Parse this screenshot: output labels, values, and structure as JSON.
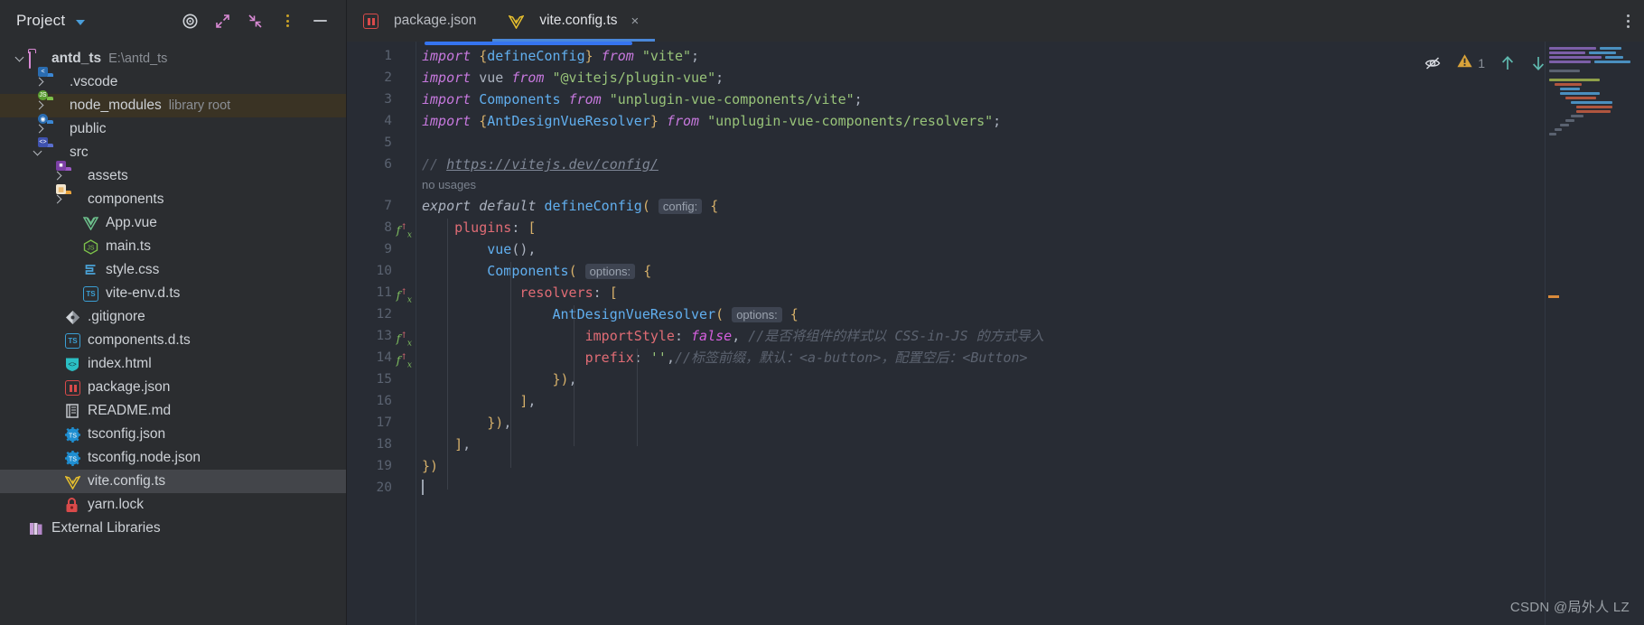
{
  "sidebar": {
    "title": "Project",
    "title_chevron": "chevron-down-icon",
    "actions": [
      {
        "name": "select-opened-file-icon",
        "label": "Select Opened File"
      },
      {
        "name": "expand-all-icon",
        "label": "Expand All"
      },
      {
        "name": "collapse-all-icon",
        "label": "Collapse All"
      },
      {
        "name": "options-menu-icon",
        "label": "Options"
      },
      {
        "name": "hide-icon",
        "label": "Hide"
      }
    ],
    "tree": [
      {
        "label": "antd_ts",
        "secondary": "E:\\antd_ts",
        "arrow": "down",
        "icon": "folder-root-icon",
        "depth": 0,
        "state": "normal",
        "bold": true
      },
      {
        "label": ".vscode",
        "secondary": "",
        "arrow": "right",
        "icon": "folder-vscode-icon",
        "depth": 1,
        "state": "normal",
        "bold": false
      },
      {
        "label": "node_modules",
        "secondary": "library root",
        "arrow": "right",
        "icon": "folder-node-icon",
        "depth": 1,
        "state": "highlighted",
        "bold": false
      },
      {
        "label": "public",
        "secondary": "",
        "arrow": "right",
        "icon": "folder-public-icon",
        "depth": 1,
        "state": "normal",
        "bold": false
      },
      {
        "label": "src",
        "secondary": "",
        "arrow": "down",
        "icon": "folder-source-icon",
        "depth": 1,
        "state": "normal",
        "bold": false
      },
      {
        "label": "assets",
        "secondary": "",
        "arrow": "right",
        "icon": "folder-assets-icon",
        "depth": 2,
        "state": "normal",
        "bold": false
      },
      {
        "label": "components",
        "secondary": "",
        "arrow": "right",
        "icon": "folder-components-icon",
        "depth": 2,
        "state": "normal",
        "bold": false
      },
      {
        "label": "App.vue",
        "secondary": "",
        "arrow": "none",
        "icon": "vue-file-icon",
        "depth": 3,
        "state": "normal",
        "bold": false
      },
      {
        "label": "main.ts",
        "secondary": "",
        "arrow": "none",
        "icon": "js-file-icon",
        "depth": 3,
        "state": "normal",
        "bold": false
      },
      {
        "label": "style.css",
        "secondary": "",
        "arrow": "none",
        "icon": "css-file-icon",
        "depth": 3,
        "state": "normal",
        "bold": false
      },
      {
        "label": "vite-env.d.ts",
        "secondary": "",
        "arrow": "none",
        "icon": "ts-file-icon",
        "depth": 3,
        "state": "normal",
        "bold": false
      },
      {
        "label": ".gitignore",
        "secondary": "",
        "arrow": "none",
        "icon": "git-file-icon",
        "depth": 2,
        "state": "normal",
        "bold": false
      },
      {
        "label": "components.d.ts",
        "secondary": "",
        "arrow": "none",
        "icon": "ts-file-icon",
        "depth": 2,
        "state": "normal",
        "bold": false
      },
      {
        "label": "index.html",
        "secondary": "",
        "arrow": "none",
        "icon": "html-file-icon",
        "depth": 2,
        "state": "normal",
        "bold": false
      },
      {
        "label": "package.json",
        "secondary": "",
        "arrow": "none",
        "icon": "npm-file-icon",
        "depth": 2,
        "state": "normal",
        "bold": false
      },
      {
        "label": "README.md",
        "secondary": "",
        "arrow": "none",
        "icon": "markdown-file-icon",
        "depth": 2,
        "state": "normal",
        "bold": false
      },
      {
        "label": "tsconfig.json",
        "secondary": "",
        "arrow": "none",
        "icon": "tsconfig-file-icon",
        "depth": 2,
        "state": "normal",
        "bold": false
      },
      {
        "label": "tsconfig.node.json",
        "secondary": "",
        "arrow": "none",
        "icon": "tsconfig-file-icon",
        "depth": 2,
        "state": "normal",
        "bold": false
      },
      {
        "label": "vite.config.ts",
        "secondary": "",
        "arrow": "none",
        "icon": "vite-file-icon",
        "depth": 2,
        "state": "selected",
        "bold": false
      },
      {
        "label": "yarn.lock",
        "secondary": "",
        "arrow": "none",
        "icon": "lock-file-icon",
        "depth": 2,
        "state": "normal",
        "bold": false
      },
      {
        "label": "External Libraries",
        "secondary": "",
        "arrow": "none",
        "icon": "external-libraries-icon",
        "depth": 0,
        "state": "normal",
        "bold": false
      }
    ]
  },
  "tabs": [
    {
      "label": "package.json",
      "icon": "npm-file-icon",
      "active": false,
      "closable": false
    },
    {
      "label": "vite.config.ts",
      "icon": "vite-file-icon",
      "active": true,
      "closable": true,
      "close_glyph": "×"
    }
  ],
  "editor_menu": {
    "name": "editor-options-icon"
  },
  "inspector": {
    "hide_icon": "eye-off-icon",
    "warning_icon": "warning-triangle-icon",
    "warning_count": "1",
    "prev_icon": "arrow-up-icon",
    "next_icon": "arrow-down-icon"
  },
  "code": {
    "lines": [
      {
        "num": "1",
        "gutter_marker": "",
        "tokens": [
          {
            "t": "import ",
            "c": "kw"
          },
          {
            "t": "{",
            "c": "br"
          },
          {
            "t": "defineConfig",
            "c": "id"
          },
          {
            "t": "}",
            "c": "br"
          },
          {
            "t": " from ",
            "c": "kw"
          },
          {
            "t": "\"vite\"",
            "c": "str"
          },
          {
            "t": ";",
            "c": "pun"
          }
        ]
      },
      {
        "num": "2",
        "gutter_marker": "",
        "tokens": [
          {
            "t": "import ",
            "c": "kw"
          },
          {
            "t": "vue",
            "c": "pun"
          },
          {
            "t": " from ",
            "c": "kw"
          },
          {
            "t": "\"@vitejs/plugin-vue\"",
            "c": "str"
          },
          {
            "t": ";",
            "c": "pun"
          }
        ]
      },
      {
        "num": "3",
        "gutter_marker": "",
        "tokens": [
          {
            "t": "import ",
            "c": "kw"
          },
          {
            "t": "Components",
            "c": "id"
          },
          {
            "t": " from ",
            "c": "kw"
          },
          {
            "t": "\"unplugin-vue-components/vite\"",
            "c": "str"
          },
          {
            "t": ";",
            "c": "pun"
          }
        ]
      },
      {
        "num": "4",
        "gutter_marker": "",
        "tokens": [
          {
            "t": "import ",
            "c": "kw"
          },
          {
            "t": "{",
            "c": "br"
          },
          {
            "t": "AntDesignVueResolver",
            "c": "id"
          },
          {
            "t": "}",
            "c": "br"
          },
          {
            "t": " from ",
            "c": "kw"
          },
          {
            "t": "\"unplugin-vue-components/resolvers\"",
            "c": "str"
          },
          {
            "t": ";",
            "c": "pun"
          }
        ]
      },
      {
        "num": "5",
        "gutter_marker": "",
        "tokens": []
      },
      {
        "num": "6",
        "gutter_marker": "",
        "tokens": [
          {
            "t": "// ",
            "c": "cmt"
          },
          {
            "t": "https://vitejs.dev/config/",
            "c": "lnk"
          }
        ]
      },
      {
        "num": "",
        "gutter_marker": "",
        "inlay": true,
        "tokens": [
          {
            "t": "no usages",
            "c": "inlay"
          }
        ]
      },
      {
        "num": "7",
        "gutter_marker": "",
        "tokens": [
          {
            "t": "export ",
            "c": "def"
          },
          {
            "t": "default ",
            "c": "def"
          },
          {
            "t": "defineConfig",
            "c": "id"
          },
          {
            "t": "(",
            "c": "br"
          },
          {
            "t": " ",
            "c": "pun"
          },
          {
            "t": "config:",
            "c": "hint"
          },
          {
            "t": " ",
            "c": "pun"
          },
          {
            "t": "{",
            "c": "br"
          }
        ]
      },
      {
        "num": "8",
        "gutter_marker": "fx",
        "tokens": [
          {
            "t": "    ",
            "c": "pun"
          },
          {
            "t": "plugins",
            "c": "prop"
          },
          {
            "t": ": ",
            "c": "pun"
          },
          {
            "t": "[",
            "c": "br"
          }
        ]
      },
      {
        "num": "9",
        "gutter_marker": "",
        "tokens": [
          {
            "t": "        ",
            "c": "pun"
          },
          {
            "t": "vue",
            "c": "id"
          },
          {
            "t": "(),",
            "c": "pun"
          }
        ]
      },
      {
        "num": "10",
        "gutter_marker": "",
        "tokens": [
          {
            "t": "        ",
            "c": "pun"
          },
          {
            "t": "Components",
            "c": "id"
          },
          {
            "t": "(",
            "c": "br"
          },
          {
            "t": " ",
            "c": "pun"
          },
          {
            "t": "options:",
            "c": "hint"
          },
          {
            "t": " ",
            "c": "pun"
          },
          {
            "t": "{",
            "c": "br"
          }
        ]
      },
      {
        "num": "11",
        "gutter_marker": "fx",
        "tokens": [
          {
            "t": "            ",
            "c": "pun"
          },
          {
            "t": "resolvers",
            "c": "prop"
          },
          {
            "t": ": ",
            "c": "pun"
          },
          {
            "t": "[",
            "c": "br"
          }
        ]
      },
      {
        "num": "12",
        "gutter_marker": "",
        "tokens": [
          {
            "t": "                ",
            "c": "pun"
          },
          {
            "t": "AntDesignVueResolver",
            "c": "id"
          },
          {
            "t": "(",
            "c": "br"
          },
          {
            "t": " ",
            "c": "pun"
          },
          {
            "t": "options:",
            "c": "hint"
          },
          {
            "t": " ",
            "c": "pun"
          },
          {
            "t": "{",
            "c": "br"
          }
        ]
      },
      {
        "num": "13",
        "gutter_marker": "fx",
        "tokens": [
          {
            "t": "                    ",
            "c": "pun"
          },
          {
            "t": "importStyle",
            "c": "prop"
          },
          {
            "t": ": ",
            "c": "pun"
          },
          {
            "t": "false",
            "c": "fal"
          },
          {
            "t": ", ",
            "c": "pun"
          },
          {
            "t": "//是否将组件的样式以 CSS-in-JS 的方式导入",
            "c": "cmt"
          }
        ]
      },
      {
        "num": "14",
        "gutter_marker": "fx",
        "tokens": [
          {
            "t": "                    ",
            "c": "pun"
          },
          {
            "t": "prefix",
            "c": "prop"
          },
          {
            "t": ": ",
            "c": "pun"
          },
          {
            "t": "''",
            "c": "str"
          },
          {
            "t": ",",
            "c": "pun"
          },
          {
            "t": "//标签前缀，默认：<a-button>，配置空后：<Button>",
            "c": "cmt"
          }
        ]
      },
      {
        "num": "15",
        "gutter_marker": "",
        "tokens": [
          {
            "t": "                ",
            "c": "pun"
          },
          {
            "t": "})",
            "c": "br"
          },
          {
            "t": ",",
            "c": "pun"
          }
        ]
      },
      {
        "num": "16",
        "gutter_marker": "",
        "tokens": [
          {
            "t": "            ",
            "c": "pun"
          },
          {
            "t": "]",
            "c": "br"
          },
          {
            "t": ",",
            "c": "pun"
          }
        ]
      },
      {
        "num": "17",
        "gutter_marker": "",
        "tokens": [
          {
            "t": "        ",
            "c": "pun"
          },
          {
            "t": "})",
            "c": "br"
          },
          {
            "t": ",",
            "c": "pun"
          }
        ]
      },
      {
        "num": "18",
        "gutter_marker": "",
        "tokens": [
          {
            "t": "    ",
            "c": "pun"
          },
          {
            "t": "]",
            "c": "br"
          },
          {
            "t": ",",
            "c": "pun"
          }
        ]
      },
      {
        "num": "19",
        "gutter_marker": "",
        "tokens": [
          {
            "t": "})",
            "c": "br"
          }
        ]
      },
      {
        "num": "20",
        "gutter_marker": "",
        "caret": true,
        "tokens": []
      }
    ]
  },
  "watermark": "CSDN @局外人 LZ",
  "colors": {
    "accent": "#3574f0",
    "warning": "#d9a33a",
    "sidebar_bg": "#2b2d30",
    "code_bg": "#282c34",
    "selection": "#43454a",
    "highlight": "#3a3324"
  }
}
